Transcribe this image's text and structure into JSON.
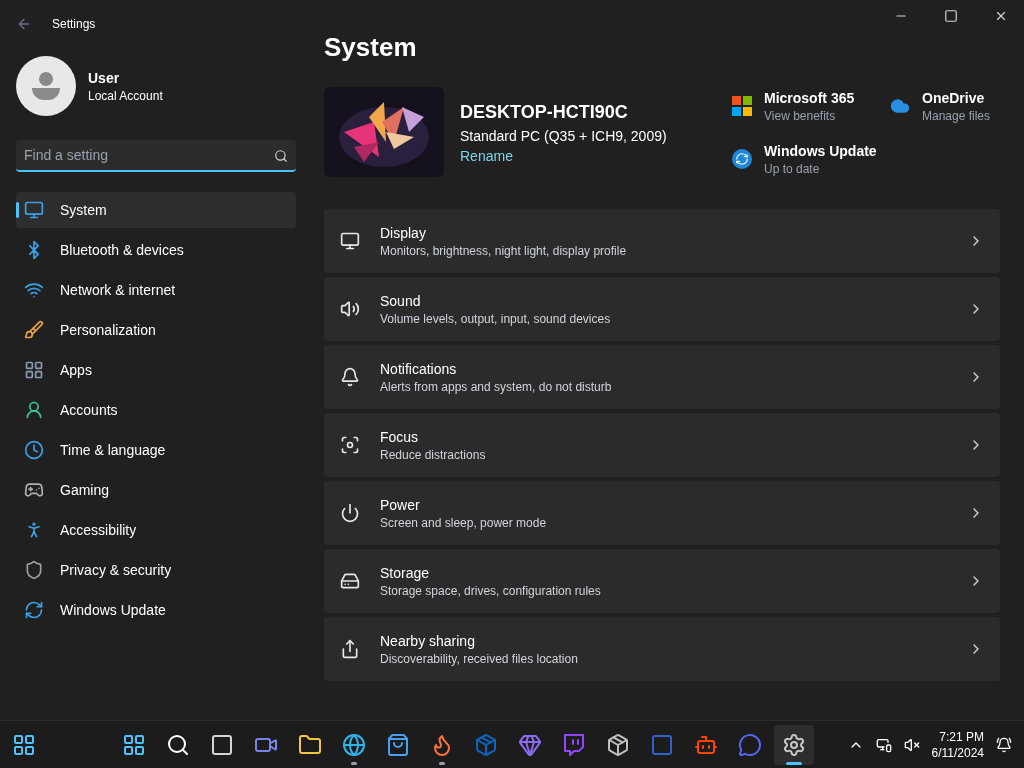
{
  "window": {
    "title": "Settings"
  },
  "user": {
    "name": "User",
    "account": "Local Account"
  },
  "search": {
    "placeholder": "Find a setting"
  },
  "nav": [
    {
      "label": "System",
      "selected": true
    },
    {
      "label": "Bluetooth & devices",
      "selected": false
    },
    {
      "label": "Network & internet",
      "selected": false
    },
    {
      "label": "Personalization",
      "selected": false
    },
    {
      "label": "Apps",
      "selected": false
    },
    {
      "label": "Accounts",
      "selected": false
    },
    {
      "label": "Time & language",
      "selected": false
    },
    {
      "label": "Gaming",
      "selected": false
    },
    {
      "label": "Accessibility",
      "selected": false
    },
    {
      "label": "Privacy & security",
      "selected": false
    },
    {
      "label": "Windows Update",
      "selected": false
    }
  ],
  "page": {
    "title": "System"
  },
  "device": {
    "name": "DESKTOP-HCTI90C",
    "model": "Standard PC (Q35 + ICH9, 2009)",
    "rename": "Rename"
  },
  "quick_links": [
    {
      "title": "Microsoft 365",
      "subtitle": "View benefits"
    },
    {
      "title": "OneDrive",
      "subtitle": "Manage files"
    },
    {
      "title": "Windows Update",
      "subtitle": "Up to date"
    }
  ],
  "settings": [
    {
      "title": "Display",
      "subtitle": "Monitors, brightness, night light, display profile"
    },
    {
      "title": "Sound",
      "subtitle": "Volume levels, output, input, sound devices"
    },
    {
      "title": "Notifications",
      "subtitle": "Alerts from apps and system, do not disturb"
    },
    {
      "title": "Focus",
      "subtitle": "Reduce distractions"
    },
    {
      "title": "Power",
      "subtitle": "Screen and sleep, power mode"
    },
    {
      "title": "Storage",
      "subtitle": "Storage space, drives, configuration rules"
    },
    {
      "title": "Nearby sharing",
      "subtitle": "Discoverability, received files location"
    }
  ],
  "taskbar": {
    "apps": [
      {
        "running": false,
        "active": false
      },
      {
        "running": false,
        "active": false
      },
      {
        "running": false,
        "active": false
      },
      {
        "running": false,
        "active": false
      },
      {
        "running": false,
        "active": false
      },
      {
        "running": true,
        "active": false
      },
      {
        "running": false,
        "active": false
      },
      {
        "running": true,
        "active": false
      },
      {
        "running": false,
        "active": false
      },
      {
        "running": false,
        "active": false
      },
      {
        "running": false,
        "active": false
      },
      {
        "running": false,
        "active": false
      },
      {
        "running": false,
        "active": false
      },
      {
        "running": false,
        "active": false
      },
      {
        "running": false,
        "active": false
      },
      {
        "running": true,
        "active": true
      }
    ],
    "time": "7:21 PM",
    "date": "6/11/2024"
  }
}
